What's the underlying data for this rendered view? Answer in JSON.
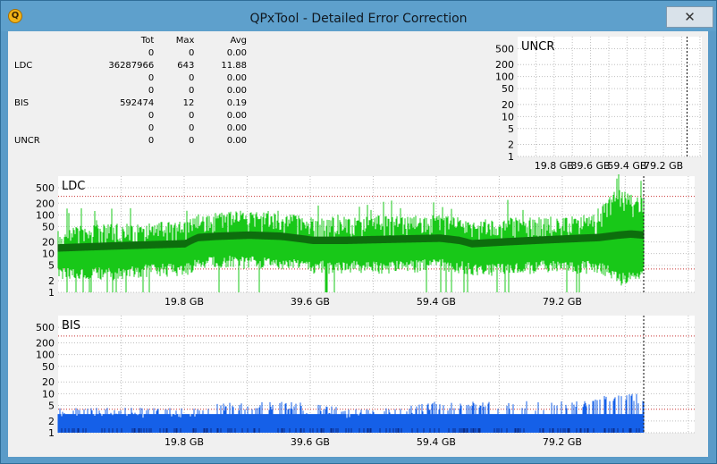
{
  "window": {
    "title": "QPxTool - Detailed Error Correction",
    "close_glyph": "✕",
    "icon_letter": "Q"
  },
  "stats": {
    "headers": [
      "",
      "Tot",
      "Max",
      "Avg"
    ],
    "rows": [
      [
        "",
        "0",
        "0",
        "0.00"
      ],
      [
        "LDC",
        "36287966",
        "643",
        "11.88"
      ],
      [
        "",
        "0",
        "0",
        "0.00"
      ],
      [
        "",
        "0",
        "0",
        "0.00"
      ],
      [
        "BIS",
        "592474",
        "12",
        "0.19"
      ],
      [
        "",
        "0",
        "0",
        "0.00"
      ],
      [
        "",
        "0",
        "0",
        "0.00"
      ],
      [
        "UNCR",
        "0",
        "0",
        "0.00"
      ]
    ]
  },
  "chart_data": [
    {
      "type": "area",
      "name": "UNCR",
      "title": "UNCR",
      "y_scale": "log",
      "ylim": [
        1,
        1000
      ],
      "y_ticks": [
        "500",
        "200",
        "100",
        "50",
        "20",
        "10",
        "5",
        "2",
        "1"
      ],
      "x_ticks": [
        "19.8 GB",
        "39.6 GB",
        "59.4 GB",
        "79.2 GB"
      ],
      "xlim_gb": [
        0,
        100
      ],
      "color": "#1560e8",
      "series": [
        {
          "x_gb": [
            0,
            92.0
          ],
          "values": [
            0,
            0
          ]
        }
      ]
    },
    {
      "type": "area",
      "name": "LDC",
      "title": "LDC",
      "y_scale": "log",
      "ylim": [
        1,
        1000
      ],
      "y_ticks": [
        "500",
        "200",
        "100",
        "50",
        "20",
        "10",
        "5",
        "2",
        "1"
      ],
      "x_ticks": [
        "19.8 GB",
        "39.6 GB",
        "59.4 GB",
        "79.2 GB"
      ],
      "xlim_gb": [
        0,
        100
      ],
      "color": "#18c818",
      "avg_color": "#0d6e0d",
      "red_lines": [
        300,
        4
      ],
      "series": [
        {
          "name": "max",
          "x_gb": [
            0,
            5,
            10,
            15,
            20,
            22,
            25,
            30,
            35,
            40,
            45,
            50,
            55,
            60,
            63,
            65,
            70,
            75,
            80,
            85,
            88,
            90,
            92
          ],
          "values": [
            40,
            45,
            50,
            55,
            60,
            90,
            100,
            120,
            100,
            70,
            75,
            80,
            80,
            85,
            75,
            60,
            70,
            75,
            80,
            90,
            400,
            300,
            250
          ]
        },
        {
          "name": "avg",
          "x_gb": [
            0,
            5,
            10,
            15,
            20,
            22,
            25,
            30,
            35,
            40,
            45,
            50,
            55,
            60,
            63,
            65,
            70,
            75,
            80,
            85,
            88,
            90,
            92
          ],
          "values": [
            14,
            15,
            16,
            17,
            18,
            26,
            28,
            30,
            28,
            22,
            22,
            23,
            24,
            25,
            22,
            18,
            20,
            22,
            24,
            26,
            30,
            32,
            30
          ]
        },
        {
          "name": "min",
          "x_gb": [
            0,
            5,
            10,
            15,
            20,
            22,
            25,
            30,
            35,
            40,
            45,
            50,
            55,
            60,
            63,
            65,
            70,
            75,
            80,
            85,
            88,
            90,
            92
          ],
          "values": [
            4,
            4,
            4,
            5,
            5,
            7,
            8,
            8,
            7,
            6,
            6,
            6,
            6,
            7,
            6,
            5,
            5,
            6,
            6,
            6,
            3,
            3,
            4
          ]
        }
      ]
    },
    {
      "type": "area",
      "name": "BIS",
      "title": "BIS",
      "y_scale": "log",
      "ylim": [
        1,
        1000
      ],
      "y_ticks": [
        "500",
        "200",
        "100",
        "50",
        "20",
        "10",
        "5",
        "2",
        "1"
      ],
      "x_ticks": [
        "19.8 GB",
        "39.6 GB",
        "59.4 GB",
        "79.2 GB"
      ],
      "xlim_gb": [
        0,
        100
      ],
      "color": "#1560e8",
      "base_color": "#0a2d8a",
      "red_lines": [
        300,
        4
      ],
      "series": [
        {
          "name": "max",
          "x_gb": [
            0,
            10,
            20,
            25,
            30,
            35,
            40,
            45,
            50,
            55,
            60,
            65,
            70,
            75,
            80,
            85,
            88,
            90,
            92
          ],
          "values": [
            4,
            4,
            4,
            5,
            6,
            6,
            5,
            4,
            4,
            5,
            6,
            6,
            6,
            6,
            7,
            7,
            12,
            10,
            9
          ]
        },
        {
          "name": "level",
          "x_gb": [
            0,
            92
          ],
          "values": [
            3,
            3
          ]
        }
      ]
    }
  ]
}
